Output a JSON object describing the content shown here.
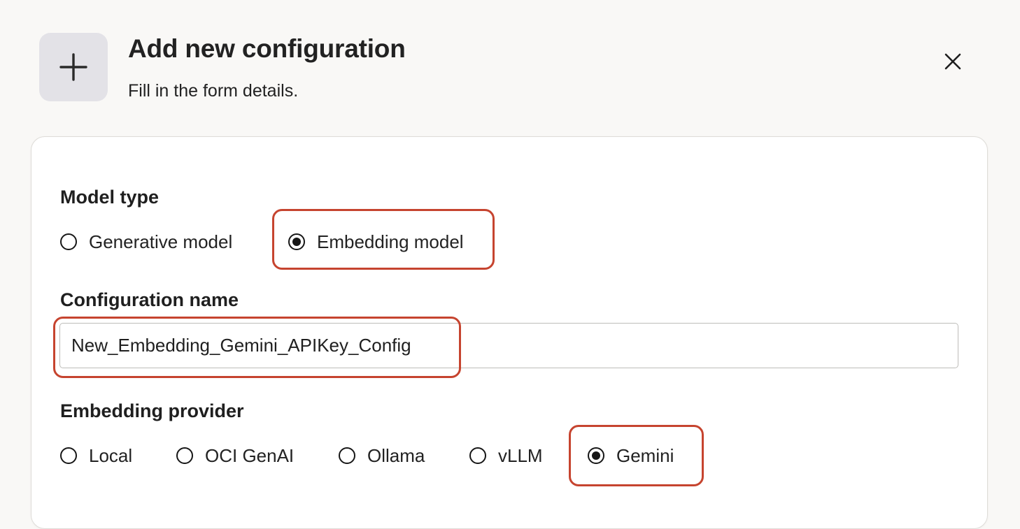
{
  "header": {
    "icon": "plus-icon",
    "title": "Add new configuration",
    "subtitle": "Fill in the form details.",
    "close_icon": "close-icon"
  },
  "form": {
    "model_type": {
      "label": "Model type",
      "options": [
        {
          "label": "Generative model",
          "selected": false
        },
        {
          "label": "Embedding model",
          "selected": true
        }
      ]
    },
    "configuration_name": {
      "label": "Configuration name",
      "value": "New_Embedding_Gemini_APIKey_Config"
    },
    "embedding_provider": {
      "label": "Embedding provider",
      "options": [
        {
          "label": "Local",
          "selected": false
        },
        {
          "label": "OCI GenAI",
          "selected": false
        },
        {
          "label": "Ollama",
          "selected": false
        },
        {
          "label": "vLLM",
          "selected": false
        },
        {
          "label": "Gemini",
          "selected": true
        }
      ]
    }
  },
  "colors": {
    "page_background": "#f9f8f6",
    "card_background": "#ffffff",
    "icon_box_background": "#e3e2e7",
    "highlight_annotation": "#c6442f",
    "radio_stroke": "#161616"
  }
}
